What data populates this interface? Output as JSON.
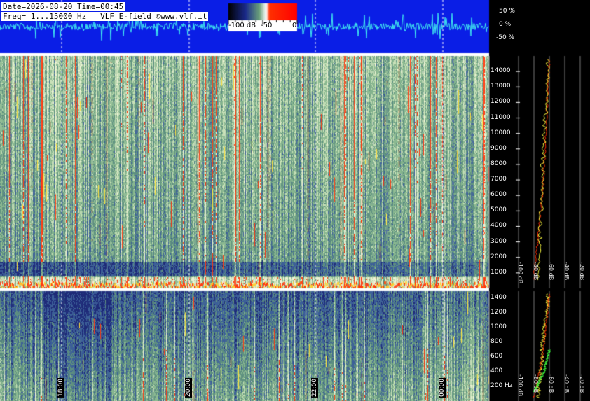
{
  "header": {
    "line1": "Date=2026-08-20 Time=00:45",
    "line2": "Freq= 1...15000 Hz   VLF E-field ©www.vlf.it"
  },
  "colorbar": {
    "labels": [
      "-100 dB",
      "-50",
      "0"
    ]
  },
  "colors": {
    "waveform_bg": "#0a1ee6",
    "waveform_trace": "#40e8f0",
    "spectrum_red": "#ff2a00",
    "spectrum_yellow": "#ffff40",
    "spectrum_green": "#40ff40",
    "background": "#000000"
  },
  "chart_data": [
    {
      "type": "line",
      "title": "",
      "ylabel": "",
      "y_ticks": [
        "50 %",
        "0 %",
        "-50 %"
      ],
      "ylim": [
        -100,
        100
      ]
    },
    {
      "type": "heatmap",
      "title": "",
      "y_ticks": [
        "1000",
        "2000",
        "3000",
        "4000",
        "5000",
        "6000",
        "7000",
        "8000",
        "9000",
        "10000",
        "11000",
        "12000",
        "13000",
        "14000"
      ],
      "ylim": [
        0,
        15000
      ],
      "x_ticks": [
        "18:00",
        "20:00",
        "22:00",
        "00:00"
      ],
      "colorscale": [
        "#000000",
        "#1a2a8a",
        "#3a6aa0",
        "#6aa07a",
        "#c8e0a0",
        "#ffffff",
        "#ff3000"
      ]
    },
    {
      "type": "heatmap",
      "title": "",
      "y_ticks": [
        "200 Hz",
        "400",
        "600",
        "800",
        "1000",
        "1200",
        "1400"
      ],
      "ylim": [
        0,
        1500
      ],
      "x_ticks": [
        "18:00",
        "20:00",
        "22:00",
        "00:00"
      ]
    },
    {
      "type": "line",
      "title": "",
      "x_ticks": [
        "-100 dB",
        "-80 dB",
        "-60 dB",
        "-40 dB",
        "-20 dB"
      ],
      "series": [
        {
          "values": [
            -75,
            -74,
            -73,
            -72,
            -71,
            -70,
            -70,
            -69,
            -68,
            -67,
            -66,
            -64,
            -63,
            -62,
            -62
          ]
        },
        {
          "values": [
            -80,
            -78,
            -76,
            -74,
            -72,
            -70,
            -68,
            -67,
            -66,
            -65,
            -64,
            -63,
            -62,
            -61,
            -60
          ]
        }
      ]
    }
  ]
}
